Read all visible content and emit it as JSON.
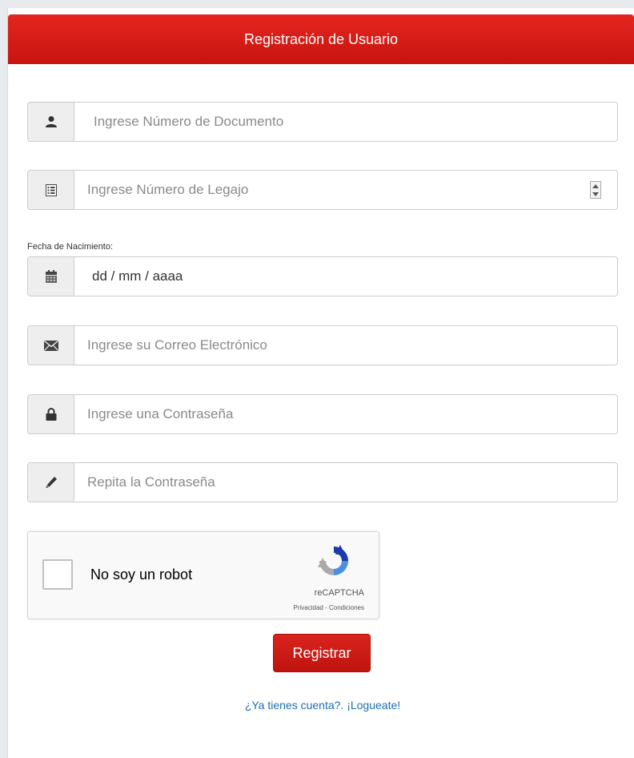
{
  "header": {
    "title": "Registración de Usuario"
  },
  "form": {
    "documento": {
      "placeholder": "Ingrese Número de Documento",
      "icon": "user-icon"
    },
    "legajo": {
      "placeholder": "Ingrese Número de Legajo",
      "icon": "list-icon"
    },
    "fecha": {
      "label": "Fecha de Nacimiento:",
      "value": "dd / mm / aaaa",
      "icon": "calendar-icon"
    },
    "correo": {
      "placeholder": "Ingrese su Correo Electrónico",
      "icon": "envelope-icon"
    },
    "contrasena": {
      "placeholder": "Ingrese una Contraseña",
      "icon": "lock-icon"
    },
    "repetir": {
      "placeholder": "Repita la Contraseña",
      "icon": "pencil-icon"
    }
  },
  "recaptcha": {
    "label": "No soy un robot",
    "brand": "reCAPTCHA",
    "links": "Privacidad - Condiciones"
  },
  "actions": {
    "submit_label": "Registrar",
    "login_link": "¿Ya tienes cuenta?. ¡Logueate!"
  },
  "colors": {
    "brand_red": "#d41c16",
    "link_blue": "#1a6fb0",
    "addon_gray": "#eeeeee"
  }
}
